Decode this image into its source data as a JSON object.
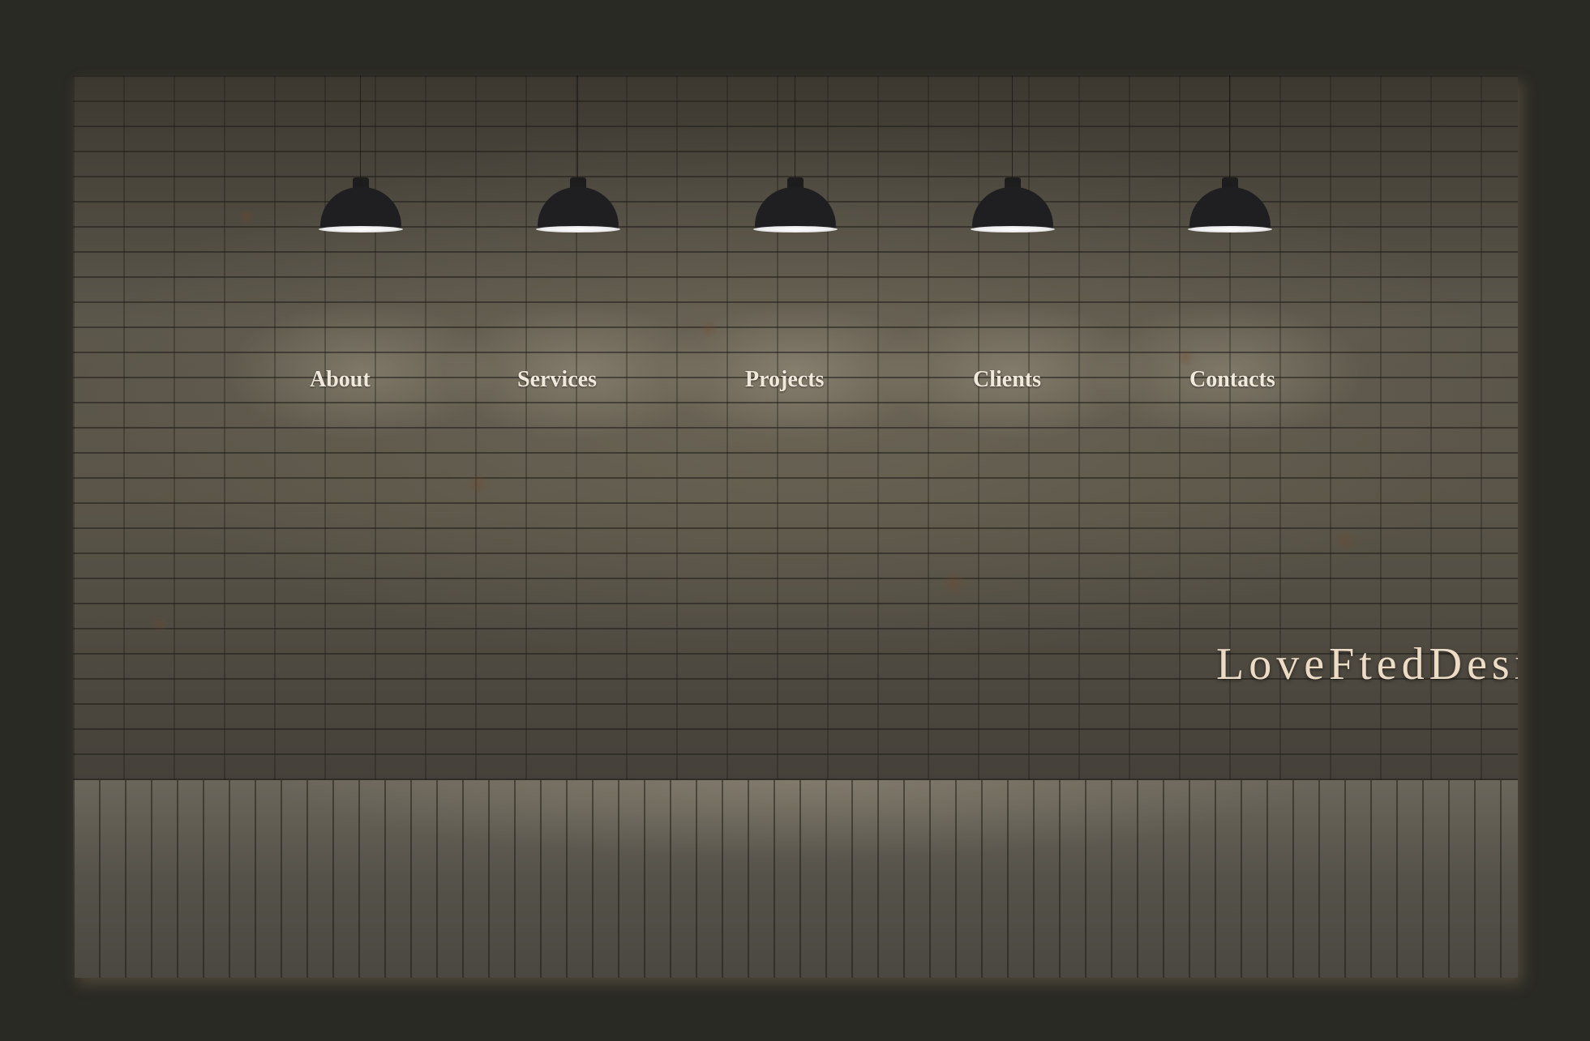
{
  "navigation": {
    "items": [
      {
        "label": "About"
      },
      {
        "label": "Services"
      },
      {
        "label": "Projects"
      },
      {
        "label": "Clients"
      },
      {
        "label": "Contacts"
      }
    ]
  },
  "brand": {
    "name": "LoveFtedDesign"
  },
  "icons": {
    "pendant": "pendant-lamp-icon"
  },
  "colors": {
    "page_background": "#2a2a24",
    "nav_text": "#f1e8dc",
    "brand_text": "#ecdcc6",
    "lamp_shade": "#1f1f21"
  }
}
